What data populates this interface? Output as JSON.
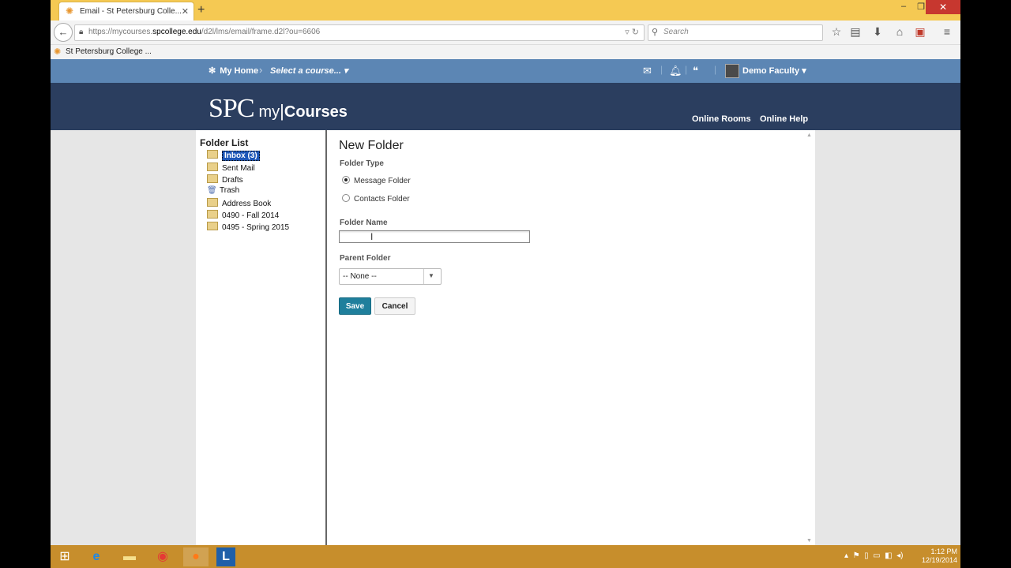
{
  "browser": {
    "tab_title": "Email - St Petersburg Colle...",
    "url_prefix": "https://mycourses.",
    "url_domain": "spcollege.edu",
    "url_path": "/d2l/lms/email/frame.d2l?ou=6606",
    "search_placeholder": "Search",
    "bookmark_label": "St Petersburg College ..."
  },
  "header": {
    "my_home": "My Home",
    "course_select": "Select a course...",
    "user_name": "Demo Faculty",
    "logo_spc": "SPC",
    "logo_my": "my",
    "logo_courses": "Courses",
    "nav_links": [
      "Online Rooms",
      "Online Help"
    ]
  },
  "sidebar": {
    "heading": "Folder List",
    "folders": [
      "Inbox (3)",
      "Sent Mail",
      "Drafts",
      "Trash",
      "Address Book",
      "0490 - Fall 2014",
      "0495 - Spring 2015"
    ]
  },
  "form": {
    "title": "New Folder",
    "folder_type_label": "Folder Type",
    "folder_type_options": [
      "Message Folder",
      "Contacts Folder"
    ],
    "folder_type_selected": "Message Folder",
    "folder_name_label": "Folder Name",
    "folder_name_value": "",
    "parent_folder_label": "Parent Folder",
    "parent_folder_value": "-- None --",
    "save_label": "Save",
    "cancel_label": "Cancel"
  },
  "taskbar": {
    "time": "1:12 PM",
    "date": "12/19/2014"
  },
  "colors": {
    "tab_strip": "#f5c953",
    "minibar": "#5c86b4",
    "navband": "#2b3e5f",
    "save_button": "#1f7f9c",
    "taskbar": "#c78e2c"
  }
}
